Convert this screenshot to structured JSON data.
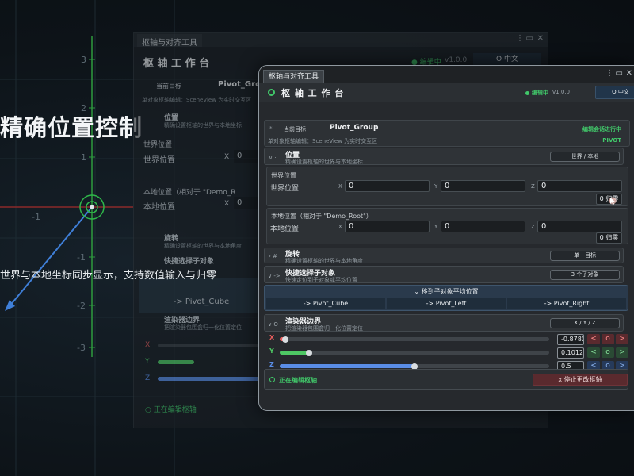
{
  "promo": {
    "headline": "精确位置控制",
    "caption": "世界与本地坐标同步显示，支持数值输入与归零"
  },
  "axis_labels": {
    "y_pos": [
      "3",
      "2",
      "1",
      "-1",
      "-2",
      "-3"
    ],
    "x_neg": "-1"
  },
  "ghost_window": {
    "tab": "枢轴与对齐工具",
    "title": "枢 轴 工 作 台",
    "status": "● 编辑中",
    "version": "v1.0.0",
    "lang": "O 中文",
    "target_label": "当前目标",
    "target_name": "Pivot_Group",
    "hint": "单对象枢轴编辑：SceneView 为实时交互区",
    "pos_title": "位置",
    "pos_sub": "精确设置枢轴的世界与本地坐标",
    "world_title": "世界位置",
    "world_label": "世界位置",
    "world_x": "0",
    "local_title": "本地位置（相对于 \"Demo_R",
    "local_label": "本地位置",
    "local_x": "0",
    "rot_title": "旋转",
    "rot_sub": "精确设置枢轴的世界与本地角度",
    "quick_title": "快捷选择子对象",
    "quick_btn": "-> Pivot_Cube",
    "render_title": "渲染器边界",
    "render_sub": "把渲染器包围盒归一化位置定位",
    "x": "X",
    "y": "Y",
    "z": "Z",
    "footer": "○ 正在编辑枢轴"
  },
  "window": {
    "tab": "枢轴与对齐工具",
    "title": "枢 轴 工 作 台",
    "status": "编辑中",
    "version": "v1.0.0",
    "lang": "O 中文",
    "target": {
      "label": "当前目标",
      "name": "Pivot_Group",
      "session": "编辑会话进行中",
      "hint": "单对象枢轴编辑：SceneView 为实时交互区",
      "badge": "PIVOT"
    },
    "position": {
      "arrow": "∨ ·",
      "title": "位置",
      "sub": "精确设置枢轴的世界与本地坐标",
      "mode_btn": "世界 / 本地",
      "world": {
        "title": "世界位置",
        "label": "世界位置",
        "x": "0",
        "y": "0",
        "z": "0",
        "reset": "0 归零"
      },
      "local": {
        "title": "本地位置（相对于 \"Demo_Root\"）",
        "label": "本地位置",
        "x": "0",
        "y": "0",
        "z": "0",
        "reset": "0 归零"
      }
    },
    "rotation": {
      "arrow": "› #",
      "title": "旋转",
      "sub": "精确设置枢轴的世界与本地角度",
      "btn": "单一目标"
    },
    "quick": {
      "arrow": "∨ ->",
      "title": "快捷选择子对象",
      "sub": "快速定位到子对象或平均位置",
      "btn": "3 个子对象",
      "avg": "⌄ 移到子对象平均位置",
      "children": [
        "-> Pivot_Cube",
        "-> Pivot_Left",
        "-> Pivot_Right"
      ]
    },
    "renderer": {
      "arrow": "∨ O",
      "title": "渲染器边界",
      "sub": "把渲染器包围盒归一化位置定位",
      "btn": "X / Y / Z",
      "sliders": [
        {
          "axis": "X",
          "value": "-0.8780",
          "fraction": 0.02,
          "color": "#e65c5c"
        },
        {
          "axis": "Y",
          "value": "0.1012",
          "fraction": 0.11,
          "color": "#4ec864"
        },
        {
          "axis": "Z",
          "value": "0.5",
          "fraction": 0.5,
          "color": "#5a8de6"
        }
      ],
      "btn_minus": "<",
      "btn_zero": "o",
      "btn_plus": ">"
    },
    "footer": {
      "status": "正在编辑枢轴",
      "stop": "x 停止更改枢轴"
    },
    "colors": {
      "accent": "#41c86a",
      "stop_bg": "#5a2a2e"
    }
  }
}
